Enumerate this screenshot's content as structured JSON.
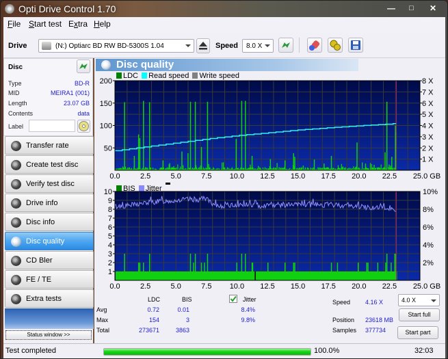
{
  "window": {
    "title": "Opti Drive Control 1.70",
    "controls": [
      "minimize",
      "maximize",
      "close"
    ]
  },
  "menu": {
    "items": [
      {
        "label": "File",
        "accel": "F"
      },
      {
        "label": "Start test",
        "accel": "S"
      },
      {
        "label": "Extra",
        "accel": "x"
      },
      {
        "label": "Help",
        "accel": "H"
      }
    ]
  },
  "toolbar": {
    "drive_label": "Drive",
    "drive_value": "(N:)  Optiarc BD RW BD-5300S 1.04",
    "speed_label": "Speed",
    "speed_value": "8.0 X",
    "icons": [
      "eject-icon",
      "refresh-icon",
      "erase-icon",
      "settings-icon",
      "save-icon"
    ]
  },
  "disc": {
    "title": "Disc",
    "fields": [
      {
        "label": "Type",
        "value": "BD-R"
      },
      {
        "label": "MID",
        "value": "MEIRA1 (001)"
      },
      {
        "label": "Length",
        "value": "23.07 GB"
      },
      {
        "label": "Contents",
        "value": "data"
      }
    ],
    "label_label": "Label",
    "label_value": ""
  },
  "nav": {
    "items": [
      {
        "label": "Transfer rate",
        "active": false
      },
      {
        "label": "Create test disc",
        "active": false
      },
      {
        "label": "Verify test disc",
        "active": false
      },
      {
        "label": "Drive info",
        "active": false
      },
      {
        "label": "Disc info",
        "active": false
      },
      {
        "label": "Disc quality",
        "active": true
      },
      {
        "label": "CD Bler",
        "active": false
      },
      {
        "label": "FE / TE",
        "active": false
      },
      {
        "label": "Extra tests",
        "active": false
      }
    ],
    "status_window": "Status window >>"
  },
  "panel": {
    "title": "Disc quality"
  },
  "chart_data": [
    {
      "type": "bar",
      "title": "LDC / Read speed",
      "legend": [
        {
          "name": "LDC",
          "color": "#008000"
        },
        {
          "name": "Read speed",
          "color": "#00ffff"
        },
        {
          "name": "Write speed",
          "color": "#808080"
        }
      ],
      "legend_position": "top-left",
      "xlabel": "GB",
      "x_ticks": [
        "0.0",
        "2.5",
        "5.0",
        "7.5",
        "10.0",
        "12.5",
        "15.0",
        "17.5",
        "20.0",
        "22.5",
        "25.0 GB"
      ],
      "xlim": [
        0,
        25
      ],
      "y_ticks": [
        "50",
        "100",
        "150",
        "200"
      ],
      "ylim": [
        0,
        200
      ],
      "y2_ticks": [
        "1 X",
        "2 X",
        "3 X",
        "4 X",
        "5 X",
        "6 X",
        "7 X",
        "8 X"
      ],
      "y2lim": [
        0,
        8
      ],
      "grid": true,
      "end_marker_gb": 23.07,
      "ldc_spikes": [
        {
          "x": 0.75,
          "y": 152
        },
        {
          "x": 1.9,
          "y": 80
        },
        {
          "x": 2.0,
          "y": 72
        },
        {
          "x": 2.3,
          "y": 155
        },
        {
          "x": 2.8,
          "y": 152
        },
        {
          "x": 1.55,
          "y": 32
        },
        {
          "x": 3.9,
          "y": 22
        },
        {
          "x": 5.45,
          "y": 42
        },
        {
          "x": 5.95,
          "y": 38
        },
        {
          "x": 6.15,
          "y": 153
        },
        {
          "x": 6.55,
          "y": 153
        },
        {
          "x": 7.05,
          "y": 52
        },
        {
          "x": 7.55,
          "y": 153
        },
        {
          "x": 9.9,
          "y": 70
        },
        {
          "x": 10.35,
          "y": 155
        },
        {
          "x": 10.65,
          "y": 155
        },
        {
          "x": 11.2,
          "y": 32
        },
        {
          "x": 12.7,
          "y": 25
        },
        {
          "x": 13.9,
          "y": 22
        },
        {
          "x": 14.6,
          "y": 38
        },
        {
          "x": 14.7,
          "y": 30
        },
        {
          "x": 16.3,
          "y": 24
        },
        {
          "x": 17.1,
          "y": 15
        },
        {
          "x": 17.7,
          "y": 32
        },
        {
          "x": 19.8,
          "y": 62
        },
        {
          "x": 20.5,
          "y": 15
        },
        {
          "x": 21.2,
          "y": 12
        },
        {
          "x": 22.1,
          "y": 40
        },
        {
          "x": 22.25,
          "y": 153
        },
        {
          "x": 22.65,
          "y": 30
        },
        {
          "x": 22.95,
          "y": 100
        },
        {
          "x": 23.0,
          "y": 85
        }
      ],
      "read_speed_x": [
        0,
        2.5,
        5,
        7.5,
        10,
        12.5,
        15,
        17.5,
        20,
        22.5,
        23.07
      ],
      "read_speed_y": [
        1.75,
        2.1,
        2.45,
        2.8,
        3.1,
        3.35,
        3.6,
        3.8,
        3.98,
        4.13,
        4.2
      ]
    },
    {
      "type": "bar",
      "title": "BIS / Jitter",
      "legend": [
        {
          "name": "BIS",
          "color": "#008000"
        },
        {
          "name": "Jitter",
          "color": "#8888ff"
        }
      ],
      "legend_position": "top-left",
      "xlabel": "GB",
      "x_ticks": [
        "0.0",
        "2.5",
        "5.0",
        "7.5",
        "10.0",
        "12.5",
        "15.0",
        "17.5",
        "20.0",
        "22.5",
        "25.0 GB"
      ],
      "xlim": [
        0,
        25
      ],
      "y_ticks": [
        "1",
        "2",
        "3",
        "4",
        "5",
        "6",
        "7",
        "8",
        "9",
        "10"
      ],
      "ylim": [
        0,
        10
      ],
      "y2_ticks": [
        "2%",
        "4%",
        "6%",
        "8%",
        "10%"
      ],
      "y2lim": [
        0,
        10
      ],
      "grid": true,
      "end_marker_gb": 23.07,
      "bis_baseline": 1,
      "bis_spikes": [
        {
          "x": 0.75,
          "y": 3
        },
        {
          "x": 1.9,
          "y": 2
        },
        {
          "x": 2.0,
          "y": 2
        },
        {
          "x": 2.3,
          "y": 2
        },
        {
          "x": 2.8,
          "y": 3
        },
        {
          "x": 6.15,
          "y": 3
        },
        {
          "x": 6.4,
          "y": 2
        },
        {
          "x": 6.55,
          "y": 3
        },
        {
          "x": 7.05,
          "y": 2
        },
        {
          "x": 7.3,
          "y": 2
        },
        {
          "x": 7.55,
          "y": 3
        },
        {
          "x": 9.95,
          "y": 2
        },
        {
          "x": 10.35,
          "y": 3
        },
        {
          "x": 10.65,
          "y": 3
        },
        {
          "x": 11.2,
          "y": 2
        },
        {
          "x": 11.25,
          "y": 2
        },
        {
          "x": 12.5,
          "y": 2
        },
        {
          "x": 13.9,
          "y": 2
        },
        {
          "x": 14.6,
          "y": 2
        },
        {
          "x": 14.7,
          "y": 2
        },
        {
          "x": 17.7,
          "y": 2
        },
        {
          "x": 18.2,
          "y": 2
        },
        {
          "x": 19.9,
          "y": 2
        },
        {
          "x": 20.6,
          "y": 2
        },
        {
          "x": 20.7,
          "y": 2
        },
        {
          "x": 21.5,
          "y": 2
        },
        {
          "x": 22.15,
          "y": 2
        },
        {
          "x": 22.25,
          "y": 3
        },
        {
          "x": 22.6,
          "y": 2
        },
        {
          "x": 22.9,
          "y": 3
        },
        {
          "x": 23.0,
          "y": 3
        }
      ],
      "bis_gap_x": 11.5,
      "jitter_x": [
        0,
        1,
        2,
        3,
        4,
        5,
        6,
        7,
        7.5,
        8,
        9,
        10,
        11,
        12,
        13,
        14,
        15,
        16,
        17,
        18,
        19,
        20,
        21,
        22,
        23
      ],
      "jitter_y": [
        8.3,
        8.4,
        8.6,
        8.8,
        8.9,
        9.0,
        9.1,
        9.1,
        9.3,
        8.4,
        8.4,
        8.5,
        8.5,
        8.4,
        8.5,
        8.5,
        8.5,
        8.5,
        8.5,
        8.5,
        8.4,
        8.3,
        8.2,
        8.1,
        8.0
      ]
    }
  ],
  "stats": {
    "col_ldc": "LDC",
    "col_bis": "BIS",
    "jitter_checked": true,
    "jitter_label": "Jitter",
    "rows": [
      {
        "label": "Avg",
        "ldc": "0.72",
        "bis": "0.01",
        "jitter": "8.4%"
      },
      {
        "label": "Max",
        "ldc": "154",
        "bis": "3",
        "jitter": "9.8%"
      },
      {
        "label": "Total",
        "ldc": "273671",
        "bis": "3863",
        "jitter": ""
      }
    ],
    "speed_label": "Speed",
    "speed_value": "4.16 X",
    "position_label": "Position",
    "position_value": "23618 MB",
    "samples_label": "Samples",
    "samples_value": "377734",
    "speed_select": "4.0 X",
    "start_full": "Start full",
    "start_part": "Start part"
  },
  "status": {
    "text": "Test completed",
    "progress_percent": 100,
    "progress_label": "100.0%",
    "elapsed": "32:03"
  }
}
